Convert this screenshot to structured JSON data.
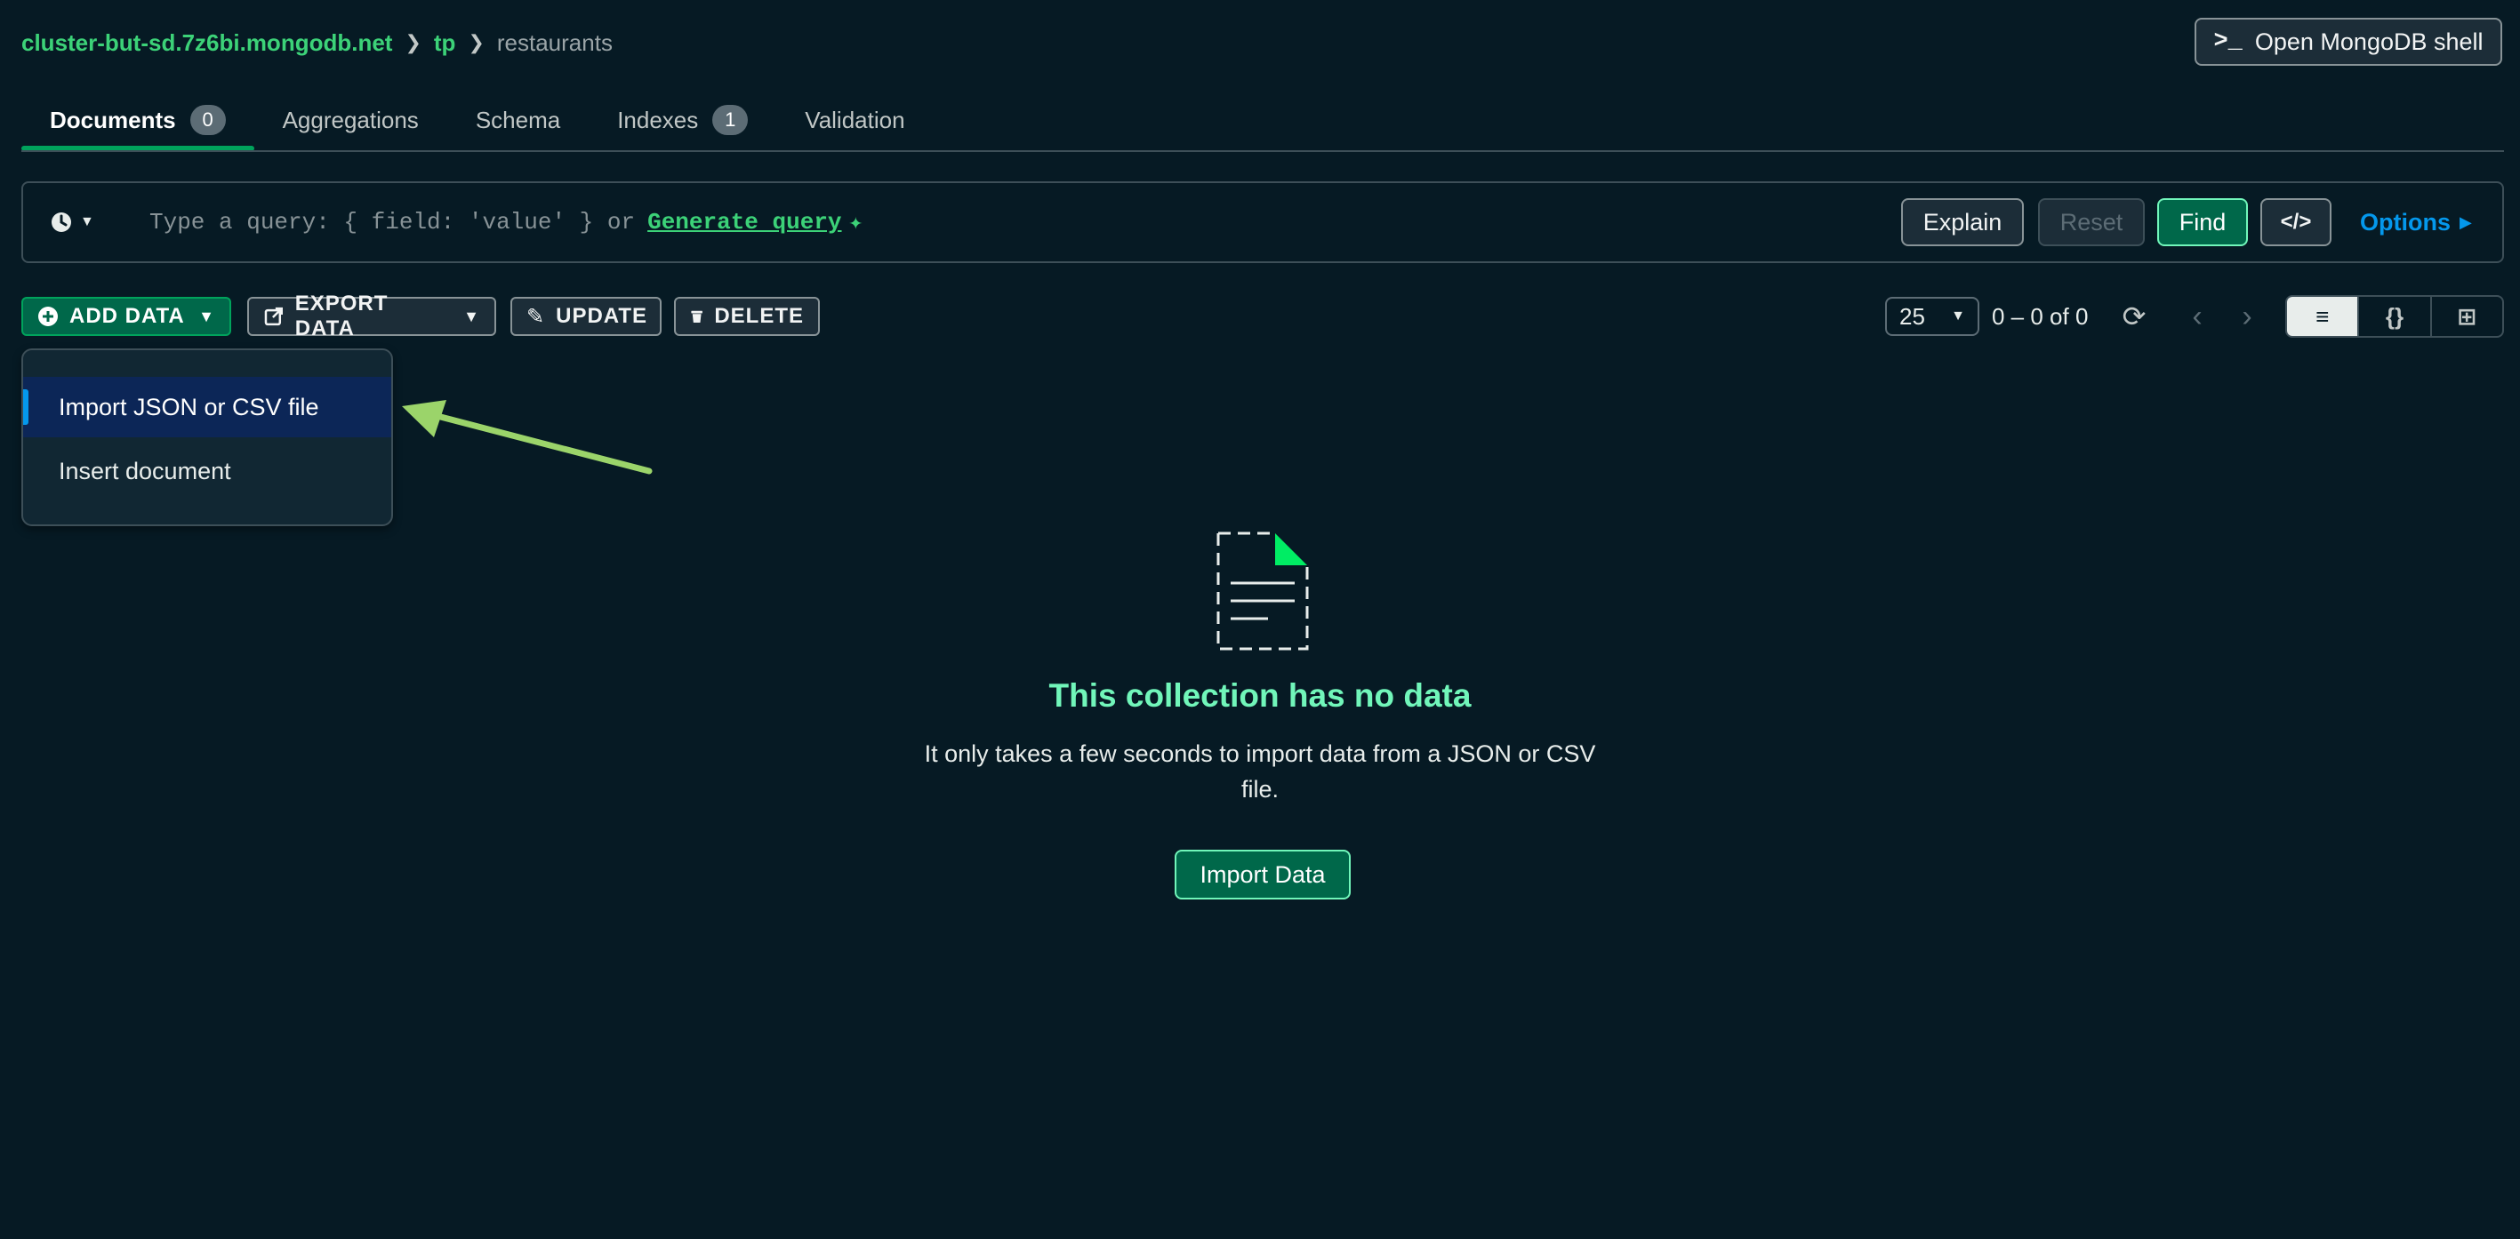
{
  "breadcrumb": {
    "cluster": "cluster-but-sd.7z6bi.mongodb.net",
    "database": "tp",
    "collection": "restaurants",
    "separator_icon": "chevron-right-icon"
  },
  "header": {
    "shell_button_label": "Open MongoDB shell",
    "shell_icon": ">_"
  },
  "tabs": [
    {
      "label": "Documents",
      "badge": "0",
      "active": true
    },
    {
      "label": "Aggregations"
    },
    {
      "label": "Schema"
    },
    {
      "label": "Indexes",
      "badge": "1"
    },
    {
      "label": "Validation"
    }
  ],
  "query": {
    "placeholder_prefix": "Type a query: { field: 'value' } or",
    "generate_link": "Generate query",
    "explain_label": "Explain",
    "reset_label": "Reset",
    "find_label": "Find",
    "code_label": "</>",
    "options_label": "Options"
  },
  "actions": {
    "add_data": "ADD DATA",
    "export_data": "EXPORT DATA",
    "update": "UPDATE",
    "delete": "DELETE"
  },
  "pagination": {
    "page_size": "25",
    "range_text": "0 – 0 of 0"
  },
  "view_modes": {
    "list_icon": "≡",
    "json_icon": "{}",
    "table_icon": "⊞",
    "active": "list"
  },
  "add_data_menu": {
    "items": [
      "Import JSON or CSV file",
      "Insert document"
    ],
    "highlighted_index": 0
  },
  "empty_state": {
    "title": "This collection has no data",
    "description": "It only takes a few seconds to import data from a JSON or CSV file.",
    "button_label": "Import Data"
  },
  "colors": {
    "background": "#061A24",
    "brand_green": "#00684A",
    "link_green": "#3CD278",
    "title_green": "#71F6BA",
    "link_blue": "#0498EC",
    "annotation_arrow": "#9BD46A"
  }
}
